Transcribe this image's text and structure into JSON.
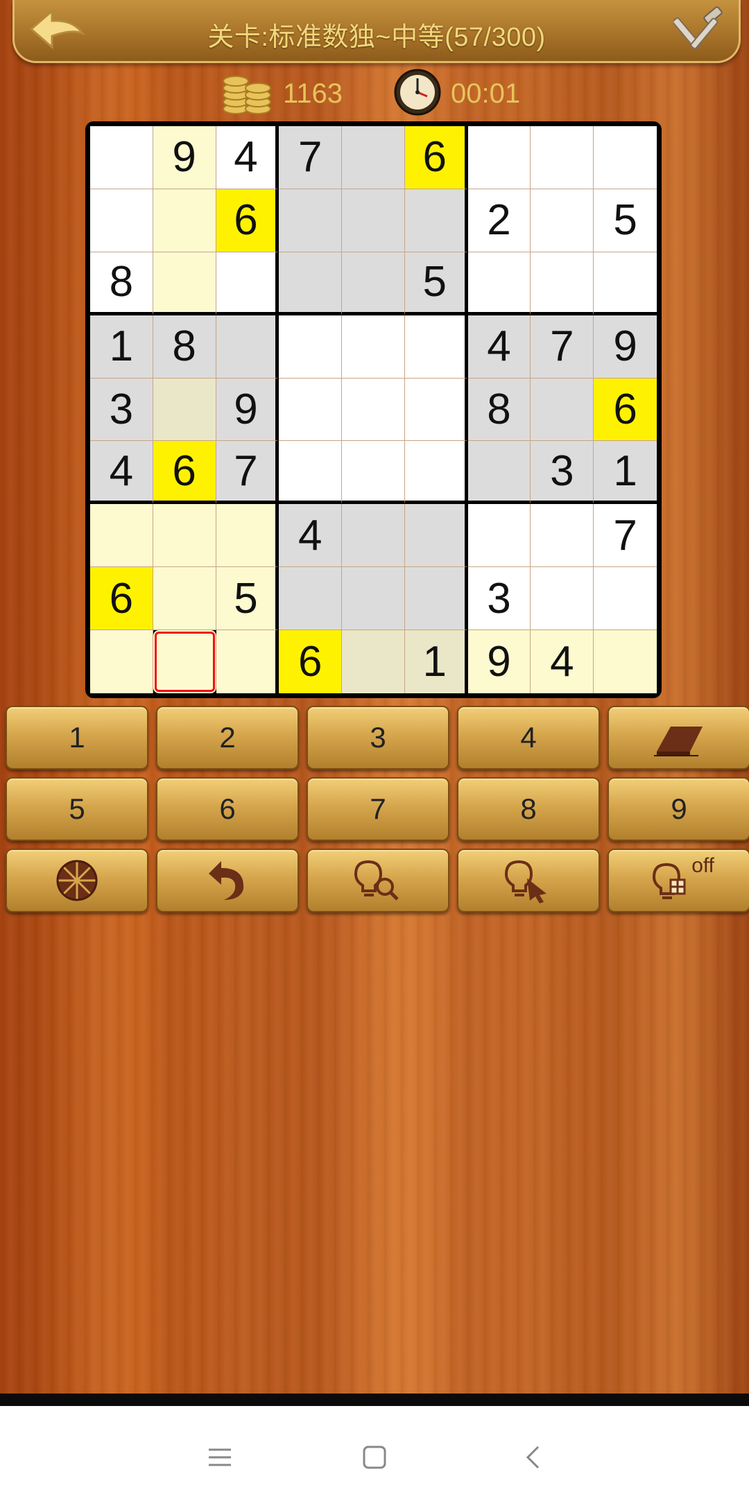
{
  "header": {
    "title": "关卡:标准数独~中等(57/300)"
  },
  "stats": {
    "coins": "1163",
    "time": "00:01"
  },
  "board": {
    "rows": [
      [
        "",
        "9",
        "4",
        "7",
        "",
        "6",
        "",
        "",
        ""
      ],
      [
        "",
        "",
        "6",
        "",
        "",
        "",
        "2",
        "",
        "5"
      ],
      [
        "8",
        "",
        "",
        "",
        "",
        "5",
        "",
        "",
        ""
      ],
      [
        "1",
        "8",
        "",
        "",
        "",
        "",
        "4",
        "7",
        "9"
      ],
      [
        "3",
        "",
        "9",
        "",
        "",
        "",
        "8",
        "",
        "6"
      ],
      [
        "4",
        "6",
        "7",
        "",
        "",
        "",
        "",
        "3",
        "1"
      ],
      [
        "",
        "",
        "",
        "4",
        "",
        "",
        "",
        "",
        "7"
      ],
      [
        "6",
        "",
        "5",
        "",
        "",
        "",
        "3",
        "",
        ""
      ],
      [
        "",
        "",
        "",
        "6",
        "",
        "1",
        "9",
        "4",
        ""
      ]
    ],
    "shading": [
      [
        "white",
        "cream",
        "white",
        "gray",
        "gray",
        "yellow",
        "white",
        "white",
        "white"
      ],
      [
        "white",
        "cream",
        "yellow",
        "gray",
        "gray",
        "gray",
        "white",
        "white",
        "white"
      ],
      [
        "white",
        "cream",
        "white",
        "gray",
        "gray",
        "gray",
        "white",
        "white",
        "white"
      ],
      [
        "gray",
        "gray",
        "gray",
        "white",
        "white",
        "white",
        "gray",
        "gray",
        "gray"
      ],
      [
        "gray",
        "creamgray",
        "gray",
        "white",
        "white",
        "white",
        "gray",
        "gray",
        "yellow"
      ],
      [
        "gray",
        "yellow",
        "gray",
        "white",
        "white",
        "white",
        "gray",
        "gray",
        "gray"
      ],
      [
        "cream",
        "cream",
        "cream",
        "gray",
        "gray",
        "gray",
        "white",
        "white",
        "white"
      ],
      [
        "yellow",
        "cream",
        "cream",
        "gray",
        "gray",
        "gray",
        "white",
        "white",
        "white"
      ],
      [
        "cream",
        "cream",
        "cream",
        "yellow",
        "creamgray",
        "creamgray",
        "cream",
        "cream",
        "cream"
      ]
    ],
    "selected": [
      8,
      1
    ]
  },
  "keypad": {
    "row1": [
      "1",
      "2",
      "3",
      "4"
    ],
    "row2": [
      "5",
      "6",
      "7",
      "8",
      "9"
    ],
    "eraser_icon": "eraser-icon",
    "row3_icons": [
      "wheel-icon",
      "undo-icon",
      "hint-search-icon",
      "hint-pointer-icon",
      "hint-off-icon"
    ],
    "hint_off_label": "off"
  },
  "colors": {
    "yellow_highlight": "#fff200",
    "cream": "#fdfad0",
    "gray": "#dcdcdc",
    "selected_border": "#ee1111",
    "title_text": "#f3d77a"
  }
}
